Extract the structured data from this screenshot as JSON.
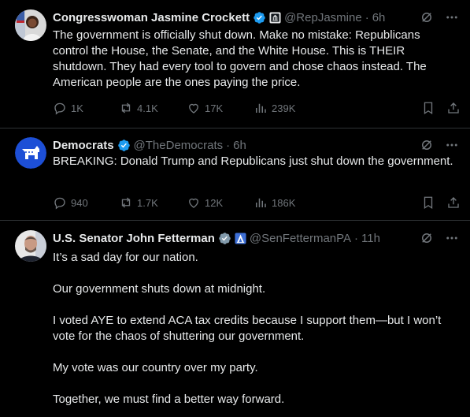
{
  "tweets": [
    {
      "name": "Congresswoman Jasmine Crockett",
      "handle": "@RepJasmine",
      "time": "6h",
      "text": [
        "The government is officially shut down. Make no mistake: Republicans control the House, the Senate, and the White House. This is THEIR shutdown. They had every tool to govern and chose chaos instead. The American people are the ones paying the price."
      ],
      "replies": "1K",
      "reposts": "4.1K",
      "likes": "17K",
      "views": "239K"
    },
    {
      "name": "Democrats",
      "handle": "@TheDemocrats",
      "time": "6h",
      "text": [
        "BREAKING: Donald Trump and Republicans just shut down the government."
      ],
      "replies": "940",
      "reposts": "1.7K",
      "likes": "12K",
      "views": "186K"
    },
    {
      "name": "U.S. Senator John Fetterman",
      "handle": "@SenFettermanPA",
      "time": "11h",
      "text": [
        "It’s a sad day for our nation.",
        "Our government shuts down at midnight.",
        "I voted AYE to extend ACA tax credits because I support them—but I won’t vote for the chaos of shuttering our government.",
        "My vote was our country over my party.",
        "Together, we must find a better way forward."
      ]
    }
  ],
  "colors": {
    "background": "#000000",
    "text": "#e7e9ea",
    "muted": "#71767b",
    "divider": "#2f3336",
    "verified": "#1d9bf0",
    "democrats": "#1d4fd6"
  }
}
